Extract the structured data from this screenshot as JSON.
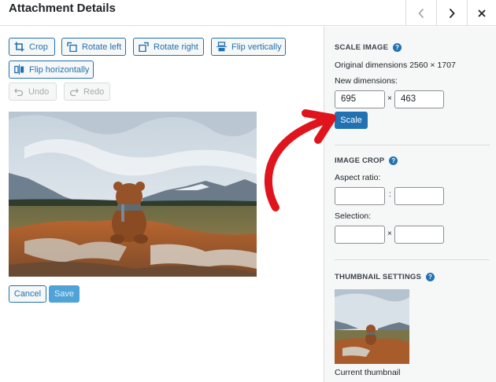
{
  "header": {
    "title": "Attachment Details"
  },
  "toolbar": {
    "crop": "Crop",
    "rotate_left": "Rotate left",
    "rotate_right": "Rotate right",
    "flip_vertically": "Flip vertically",
    "flip_horizontally": "Flip horizontally",
    "undo": "Undo",
    "redo": "Redo"
  },
  "actions": {
    "cancel": "Cancel",
    "save": "Save"
  },
  "scale": {
    "title": "SCALE IMAGE",
    "original": "Original dimensions 2560 × 1707",
    "new_label": "New dimensions:",
    "width": "695",
    "height": "463",
    "times": "×",
    "button": "Scale"
  },
  "crop": {
    "title": "IMAGE CROP",
    "aspect_label": "Aspect ratio:",
    "aspect_sep": ":",
    "selection_label": "Selection:",
    "selection_sep": "×"
  },
  "thumbnail": {
    "title": "THUMBNAIL SETTINGS",
    "caption": "Current thumbnail"
  },
  "colors": {
    "accent": "#2271b1",
    "arrow": "#e0141c"
  }
}
